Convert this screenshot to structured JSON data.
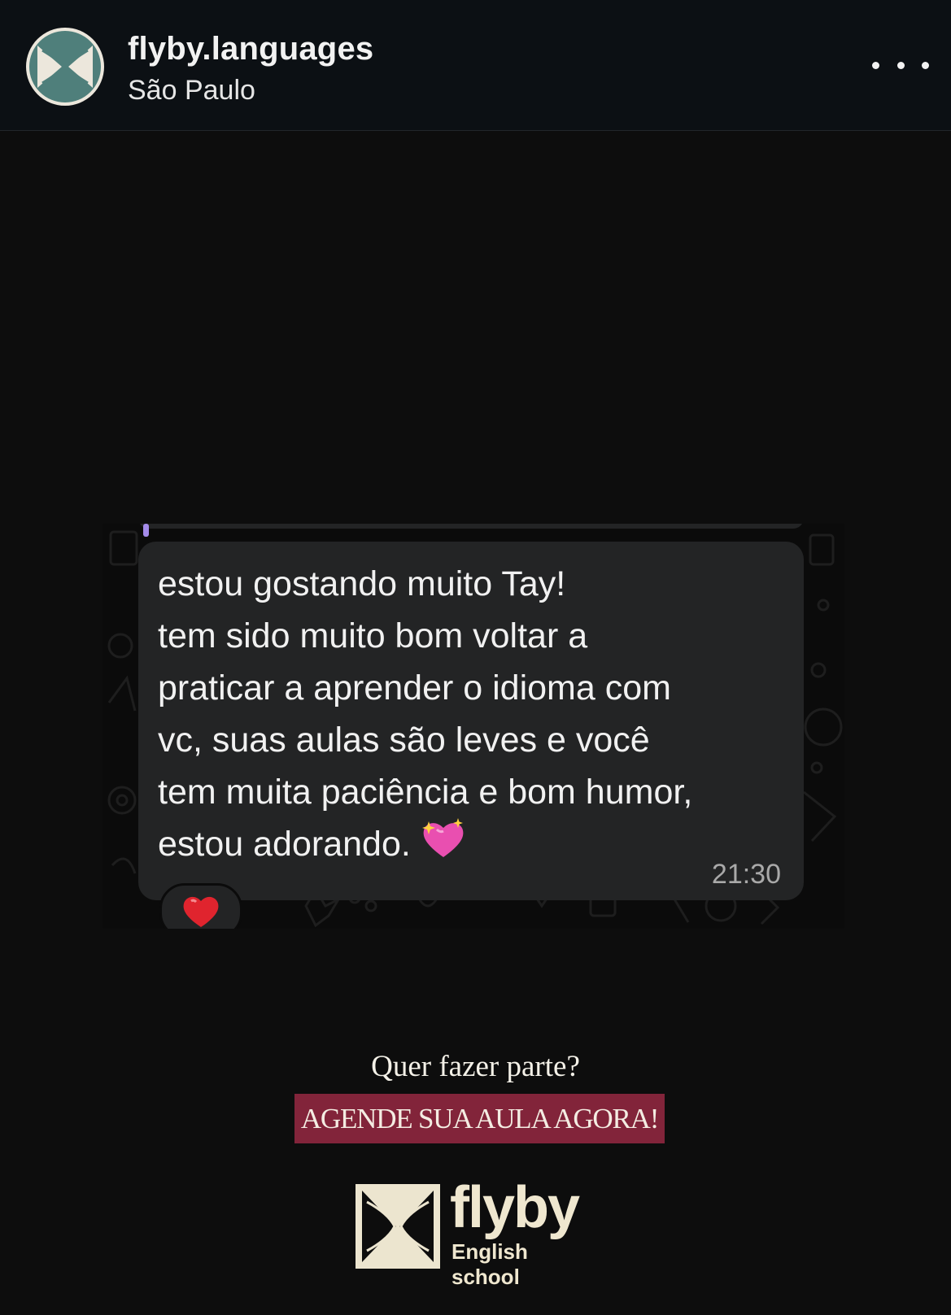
{
  "header": {
    "username": "flyby.languages",
    "location": "São Paulo",
    "avatar_icon": "flyby-logo-icon",
    "more_icon": "more-options-icon"
  },
  "chat": {
    "message_lines": [
      "estou gostando muito Tay!",
      "tem sido muito bom voltar a",
      "praticar a aprender o idioma com",
      "vc, suas aulas são leves e você",
      "tem muita paciência e bom humor,",
      "estou adorando."
    ],
    "emoji": "sparkling-heart-icon",
    "time": "21:30",
    "reaction": "red-heart-icon"
  },
  "cta": {
    "question": "Quer fazer parte?",
    "button": "AGENDE SUA AULA AGORA!"
  },
  "brand": {
    "name": "flyby",
    "subtitle": "English school"
  },
  "colors": {
    "header_bg": "#0c1014",
    "post_bg": "#0d0d0d",
    "bubble_bg": "#232425",
    "cta_button_bg": "#82243a",
    "brand_cream": "#efe7cf",
    "avatar_teal": "#4f7f7b"
  }
}
